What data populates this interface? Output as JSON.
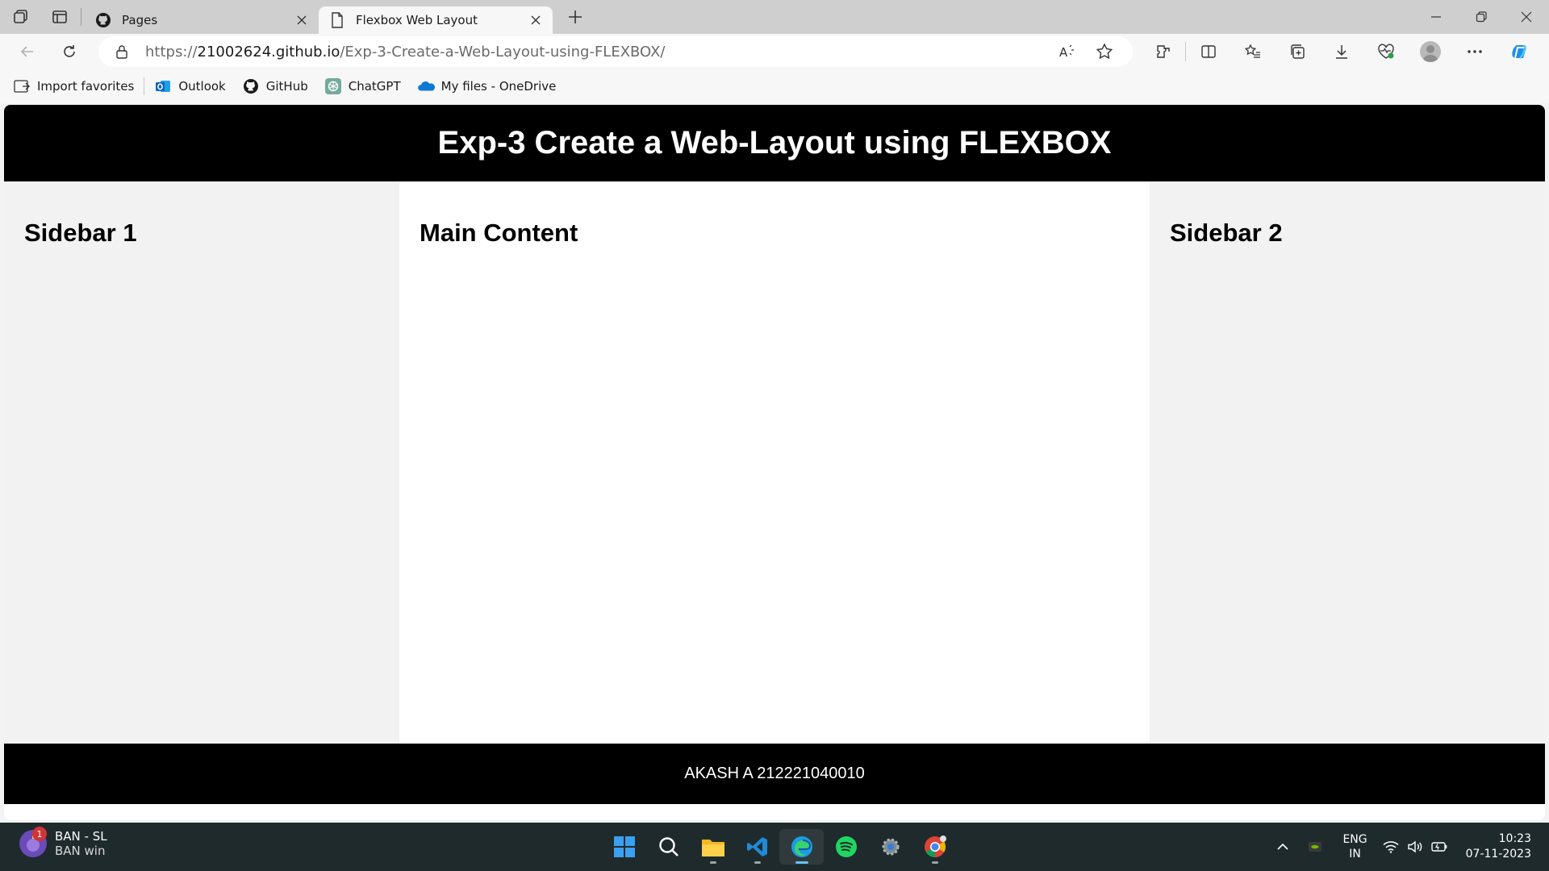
{
  "browser": {
    "tabs": [
      {
        "title": "Pages",
        "active": false
      },
      {
        "title": "Flexbox Web Layout",
        "active": true
      }
    ],
    "address": {
      "prefix": "https://",
      "host": "21002624.github.io",
      "path": "/Exp-3-Create-a-Web-Layout-using-FLEXBOX/"
    },
    "favorites": [
      {
        "label": "Import favorites",
        "icon": "import-favorites-icon"
      },
      {
        "label": "Outlook",
        "icon": "outlook-icon"
      },
      {
        "label": "GitHub",
        "icon": "github-icon"
      },
      {
        "label": "ChatGPT",
        "icon": "chatgpt-icon"
      },
      {
        "label": "My files - OneDrive",
        "icon": "onedrive-icon"
      }
    ],
    "accent_color": "#1a73e8"
  },
  "page": {
    "header_title": "Exp-3 Create a Web-Layout using FLEXBOX",
    "sidebar1_heading": "Sidebar 1",
    "main_heading": "Main Content",
    "sidebar2_heading": "Sidebar 2",
    "footer_text": "AKASH A 212221040010",
    "colors": {
      "header_bg": "#000000",
      "sidebar_bg": "#f2f2f2",
      "main_bg": "#ffffff"
    }
  },
  "taskbar": {
    "weather": {
      "line1": "BAN - SL",
      "line2": "BAN win",
      "badge": "1"
    },
    "apps": [
      "windows-start-icon",
      "search-icon",
      "file-explorer-icon",
      "vscode-icon",
      "edge-icon",
      "spotify-icon",
      "settings-icon",
      "chrome-icon"
    ],
    "language": {
      "line1": "ENG",
      "line2": "IN"
    },
    "time": "10:23",
    "date": "07-11-2023"
  }
}
